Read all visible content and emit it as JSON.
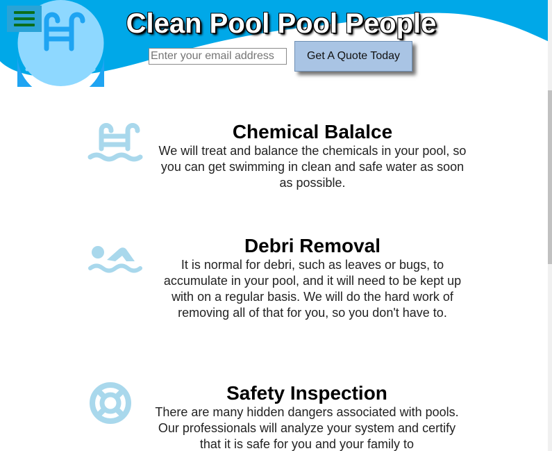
{
  "colors": {
    "wave_blue": "#00a8e8",
    "logo_blue": "#8ed8ff",
    "icon_blue": "#a9d8ec",
    "menu_green": "#0b6e1c",
    "button_blue": "#a9c4e4"
  },
  "header": {
    "menu_icon": "hamburger-menu-icon",
    "logo_icon": "pool-ladder-icon",
    "title": "Clean Pool Pool People",
    "email_placeholder": "Enter your email address",
    "email_value": "",
    "quote_button_label": "Get A Quote Today"
  },
  "services": [
    {
      "icon": "pool-ladder-icon",
      "title": "Chemical Balalce",
      "text": "We will treat and balance the chemicals in your pool, so you can get swimming in clean and safe water as soon as possible."
    },
    {
      "icon": "swimmer-icon",
      "title": "Debri Removal",
      "text": "It is normal for debri, such as leaves or bugs, to accumulate in your pool, and it will need to be kept up with on a regular basis. We will do the hard work of removing all of that for you, so you don't have to."
    },
    {
      "icon": "lifebuoy-icon",
      "title": "Safety Inspection",
      "text": "There are many hidden dangers associated with pools. Our professionals will analyze your system and certify that it is safe for you and your family to"
    }
  ]
}
